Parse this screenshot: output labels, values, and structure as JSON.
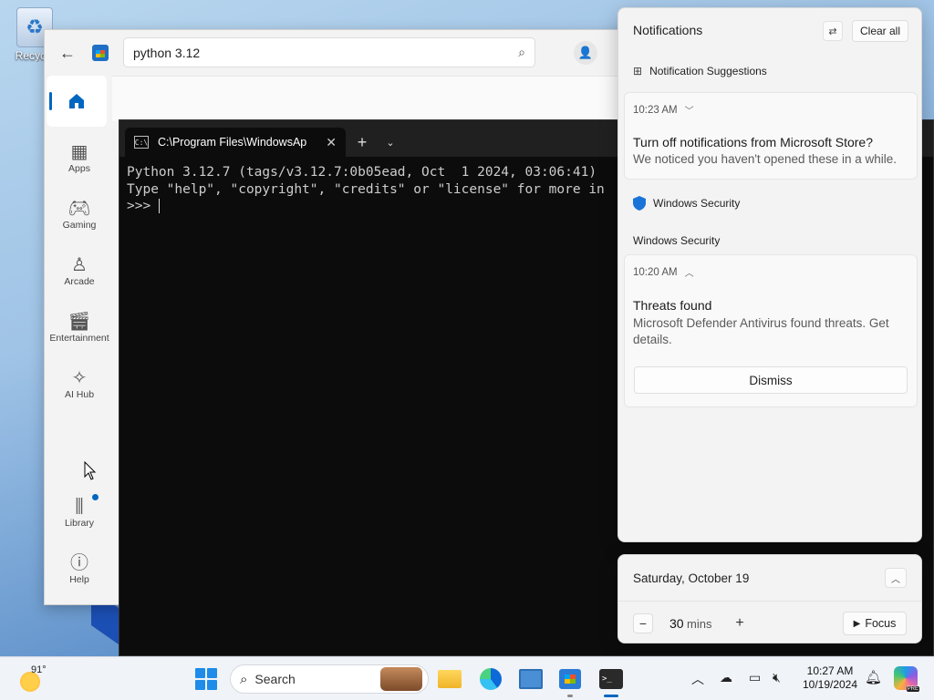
{
  "desktop": {
    "recycle_label": "Recycle"
  },
  "store": {
    "search_value": "python 3.12",
    "nav": [
      {
        "label": "Apps",
        "icon": "apps-icon"
      },
      {
        "label": "Gaming",
        "icon": "gamepad-icon"
      },
      {
        "label": "Arcade",
        "icon": "joystick-icon"
      },
      {
        "label": "Entertainment",
        "icon": "clapperboard-icon"
      },
      {
        "label": "AI Hub",
        "icon": "sparkle-icon"
      },
      {
        "label": "Library",
        "icon": "library-icon"
      },
      {
        "label": "Help",
        "icon": "help-icon"
      }
    ],
    "accent": "#0067c0"
  },
  "terminal": {
    "tab_title": "C:\\Program Files\\WindowsAp",
    "lines": [
      "Python 3.12.7 (tags/v3.12.7:0b05ead, Oct  1 2024, 03:06:41)",
      "Type \"help\", \"copyright\", \"credits\" or \"license\" for more in",
      ">>> "
    ]
  },
  "notifications": {
    "title": "Notifications",
    "clear_all": "Clear all",
    "suggestions": "Notification Suggestions",
    "store_notif": {
      "time": "10:23 AM",
      "title": "Turn off notifications from Microsoft Store?",
      "text": "We noticed you haven't opened these in a while."
    },
    "security_app": "Windows Security",
    "security_group": "Windows Security",
    "security_notif": {
      "time": "10:20 AM",
      "title": "Threats found",
      "text": "Microsoft Defender Antivirus found threats. Get details.",
      "dismiss": "Dismiss"
    }
  },
  "calendar": {
    "date": "Saturday, October 19",
    "focus_value": "30",
    "focus_unit": "mins",
    "focus_label": "Focus"
  },
  "taskbar": {
    "temperature": "91°",
    "search_label": "Search",
    "time": "10:27 AM",
    "date": "10/19/2024"
  }
}
